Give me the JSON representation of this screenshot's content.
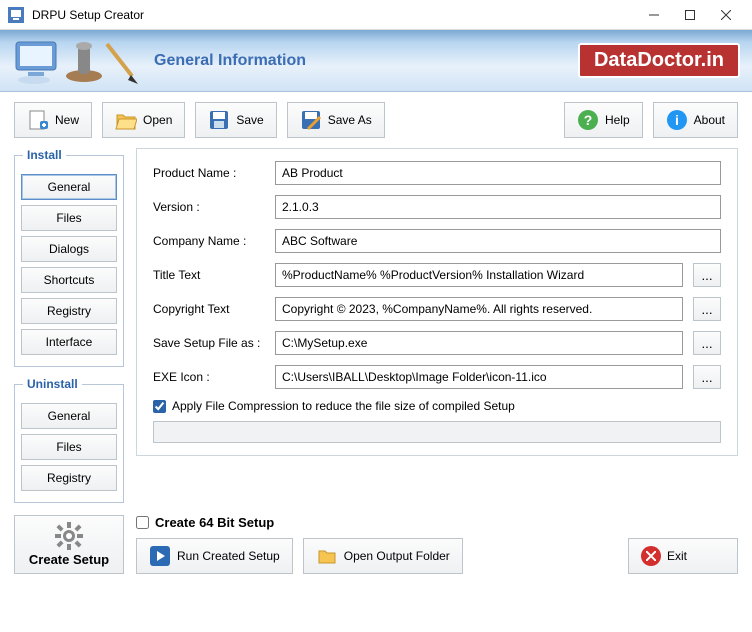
{
  "window": {
    "title": "DRPU Setup Creator"
  },
  "header": {
    "page_title": "General Information",
    "brand": "DataDoctor.in"
  },
  "toolbar": {
    "new": "New",
    "open": "Open",
    "save": "Save",
    "save_as": "Save As",
    "help": "Help",
    "about": "About"
  },
  "nav": {
    "install_title": "Install",
    "install": [
      "General",
      "Files",
      "Dialogs",
      "Shortcuts",
      "Registry",
      "Interface"
    ],
    "uninstall_title": "Uninstall",
    "uninstall": [
      "General",
      "Files",
      "Registry"
    ]
  },
  "form": {
    "product_name_label": "Product Name :",
    "product_name": "AB Product",
    "version_label": "Version :",
    "version": "2.1.0.3",
    "company_label": "Company Name :",
    "company": "ABC Software",
    "title_text_label": "Title Text",
    "title_text": "%ProductName% %ProductVersion% Installation Wizard",
    "copyright_label": "Copyright Text",
    "copyright": "Copyright © 2023, %CompanyName%. All rights reserved.",
    "save_as_label": "Save Setup File as :",
    "save_as": "C:\\MySetup.exe",
    "exe_icon_label": "EXE Icon :",
    "exe_icon": "C:\\Users\\IBALL\\Desktop\\Image Folder\\icon-11.ico",
    "compression_label": "Apply File Compression to reduce the file size of compiled Setup",
    "compression_checked": true,
    "browse": "..."
  },
  "footer": {
    "create_setup": "Create Setup",
    "create_64": "Create 64 Bit Setup",
    "create_64_checked": false,
    "run_created": "Run Created Setup",
    "open_output": "Open Output Folder",
    "exit": "Exit"
  }
}
